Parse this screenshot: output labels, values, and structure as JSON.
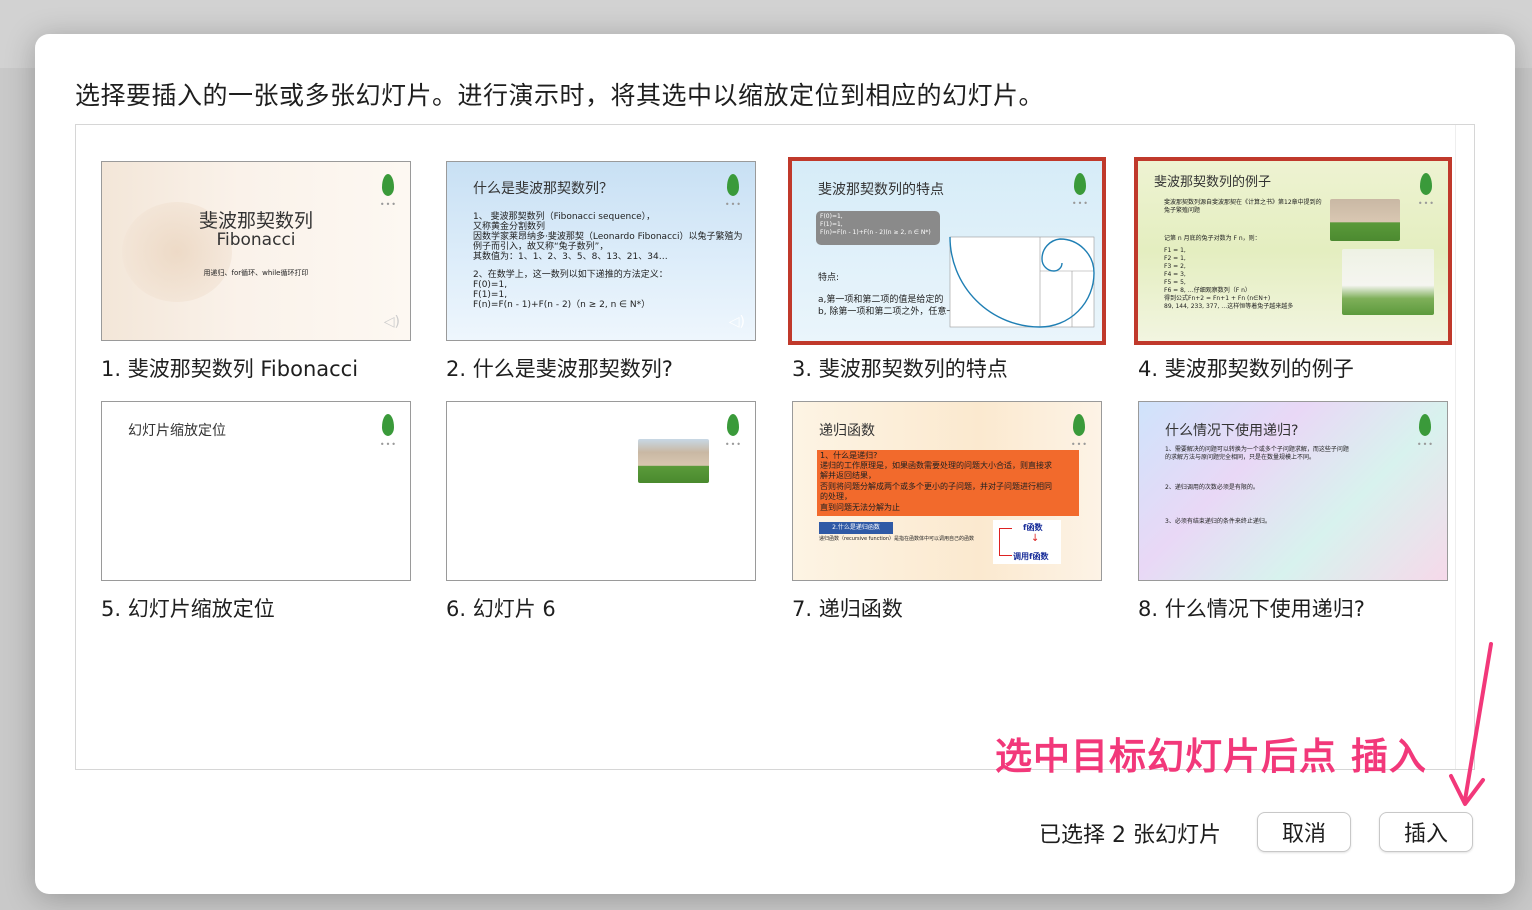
{
  "dialog": {
    "instruction": "选择要插入的一张或多张幻灯片。进行演示时，将其选中以缩放定位到相应的幻灯片。",
    "status": "已选择 2 张幻灯片",
    "cancel_label": "取消",
    "insert_label": "插入"
  },
  "annotation": {
    "text": "选中目标幻灯片后点 插入",
    "color": "#f2387a"
  },
  "slides": [
    {
      "caption": "1. 斐波那契数列 Fibonacci",
      "title": "斐波那契数列",
      "subtitle": "Fibonacci",
      "note": "用递归、for循环、while循环打印",
      "selected": false
    },
    {
      "caption": "2. 什么是斐波那契数列?",
      "title": "什么是斐波那契数列？",
      "lines": [
        "1、 斐波那契数列（Fibonacci sequence），",
        "又称黄金分割数列",
        "因数学家莱昂纳多·斐波那契（Leonardo Fibonacci）以兔子繁殖为",
        "例子而引入，故又称“兔子数列”，",
        "其数值为：1、1、2、3、5、8、13、21、34…",
        "",
        "2、在数学上，这一数列以如下递推的方法定义：",
        "F(0)=1,",
        "F(1)=1,",
        "F(n)=F(n - 1)+F(n - 2)（n ≥ 2, n ∈ N*）"
      ],
      "selected": false
    },
    {
      "caption": "3. 斐波那契数列的特点",
      "title": "斐波那契数列的特点",
      "box_lines": [
        "F(0)=1,",
        "F(1)=1,",
        "F(n)=F(n - 1)+F(n - 2)(n ≥ 2, n ∈ N*)"
      ],
      "lines": [
        "特点:",
        "",
        "a,第一项和第二项的值是给定的",
        "b, 除第一项和第二项之外，任意一"
      ],
      "selected": true
    },
    {
      "caption": "4. 斐波那契数列的例子",
      "title": "斐波那契数列的例子",
      "lines": [
        "斐波那契数列源自斐波那契在《计算之书》第12章中提到的",
        "兔子繁殖问题",
        "记第 n 月底的兔子对数为 F n，则：",
        "F1 = 1,",
        "F2 = 1,",
        "F3 = 2,",
        "F4 = 3,",
        "F5 = 5,",
        "F6 = 8, …仔细观察数列（F n）",
        "89, 144, 233, 377, …这样恒等着兔子越来越多",
        "得到公式Fn+2 = Fn+1 + Fn (n∈N+)"
      ],
      "selected": true
    },
    {
      "caption": "5. 幻灯片缩放定位",
      "title": "幻灯片缩放定位",
      "selected": false
    },
    {
      "caption": "6. 幻灯片 6",
      "selected": false
    },
    {
      "caption": "7. 递归函数",
      "title": "递归函数",
      "box_lines": [
        "1、什么是递归?",
        "递归的工作原理是，如果函数需要处理的问题大小合适，则直接求",
        "解并返回结果，",
        "否则将问题分解成两个或多个更小的子问题，并对子问题进行相同",
        "的处理，",
        "直到问题无法分解为止"
      ],
      "tag": "2.什么是递归函数",
      "note": "递归函数（recursive function）是指在函数体中可以调用自己的函数",
      "diagram_top": "f函数",
      "diagram_bottom": "调用f函数",
      "selected": false
    },
    {
      "caption": "8. 什么情况下使用递归?",
      "title": "什么情况下使用递归?",
      "lines": [
        "1、需要解决的问题可以转换为一个或多个子问题求解，而这些子问题",
        "的求解方法与原问题完全相同，只是在数量规模上不同。",
        "",
        "",
        "2、递归调用的次数必须是有限的。",
        "",
        "",
        "3、必须有结束递归的条件来终止递归。"
      ],
      "selected": false
    }
  ]
}
